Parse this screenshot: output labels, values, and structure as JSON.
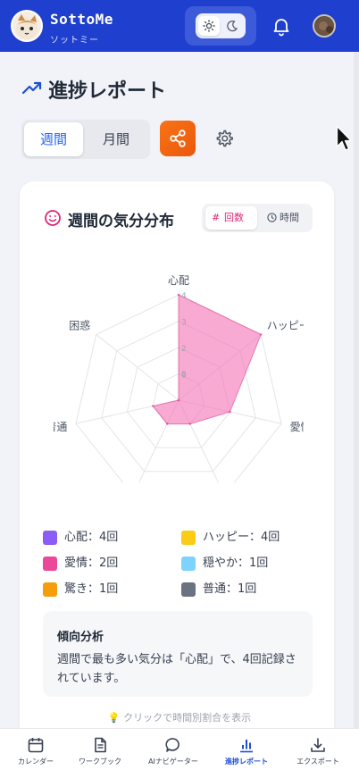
{
  "header": {
    "app_title": "SottoMe",
    "app_subtitle": "ソットミー"
  },
  "page": {
    "title": "進捗レポート"
  },
  "period_tabs": {
    "weekly": "週間",
    "monthly": "月間",
    "selected": "週間"
  },
  "card": {
    "title": "週間の気分分布",
    "mode_toggle": {
      "count": "回数",
      "time": "時間",
      "selected": "回数"
    }
  },
  "chart_data": {
    "type": "radar",
    "categories": [
      "心配",
      "ハッピー",
      "愛情",
      "穏やか",
      "驚き",
      "普通",
      "困惑"
    ],
    "values": [
      4,
      4,
      2,
      1,
      1,
      1,
      0
    ],
    "rlim": [
      0,
      4
    ],
    "radial_ticks": [
      "0",
      "1",
      "2",
      "3",
      "4"
    ],
    "fill_color": "#f472b6",
    "line_color": "#db2777"
  },
  "legend": [
    {
      "label": "心配：4回",
      "color": "#8b5cf6"
    },
    {
      "label": "ハッピー：4回",
      "color": "#facc15"
    },
    {
      "label": "愛情：2回",
      "color": "#ec4899"
    },
    {
      "label": "穏やか：1回",
      "color": "#7dd3fc"
    },
    {
      "label": "驚き：1回",
      "color": "#f59e0b"
    },
    {
      "label": "普通：1回",
      "color": "#6b7280"
    }
  ],
  "analysis": {
    "title": "傾向分析",
    "body": "週間で最も多い気分は「心配」で、4回記録されています。"
  },
  "hint": "💡 クリックで時間別割合を表示",
  "bottom_nav": {
    "items": [
      {
        "label": "カレンダー",
        "icon": "calendar-icon"
      },
      {
        "label": "ワークブック",
        "icon": "document-icon"
      },
      {
        "label": "AIナビゲーター",
        "icon": "chat-bubble-icon"
      },
      {
        "label": "進捗レポート",
        "icon": "bar-chart-icon",
        "active": true
      },
      {
        "label": "エクスポート",
        "icon": "download-icon"
      }
    ]
  },
  "colors": {
    "header_bg": "#1f3fce",
    "accent_blue": "#2563eb",
    "accent_pink": "#db2777",
    "share_orange": "#f97316"
  }
}
